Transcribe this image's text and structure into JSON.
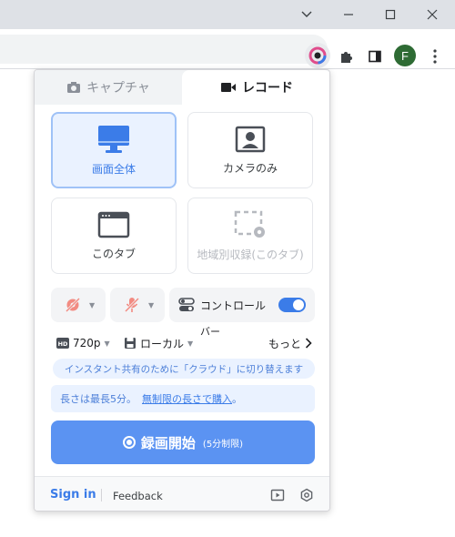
{
  "browser": {
    "profile_initial": "F"
  },
  "popup": {
    "tabs": {
      "capture": "キャプチャ",
      "record": "レコード"
    },
    "modes": {
      "screen": "画面全体",
      "camera": "カメラのみ",
      "tab": "このタブ",
      "region": "地域別収録(このタブ)"
    },
    "controls": {
      "control_label": "コントロール",
      "overflow_text": "バー",
      "control_enabled": true
    },
    "options": {
      "resolution": "720p",
      "storage": "ローカル",
      "more": "もっと"
    },
    "notice": "インスタント共有のために「クラウド」に切り替えます",
    "limit": {
      "text": "長さは最長5分。",
      "link": "無制限の長さで購入",
      "suffix": "。"
    },
    "start": {
      "label": "録画開始",
      "sub": "(5分制限)"
    },
    "footer": {
      "signin": "Sign in",
      "feedback": "Feedback"
    }
  },
  "colors": {
    "accent": "#3b7ce8",
    "start_button": "#5b93f2",
    "muted_red": "#f28b82"
  }
}
